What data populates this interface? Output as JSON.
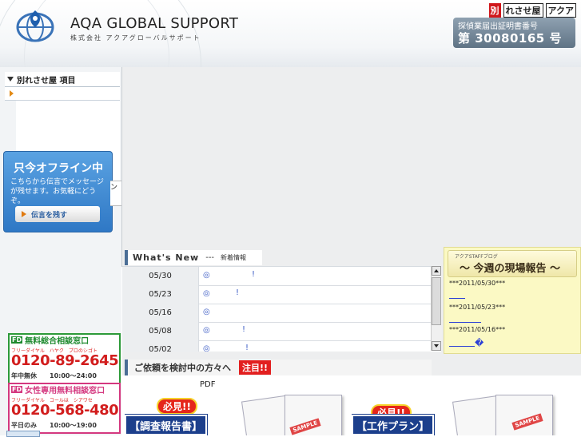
{
  "header": {
    "brand": "AQA GLOBAL SUPPORT",
    "brand_sub": "株式会社 アクアグローバルサポート",
    "tags": [
      "別",
      "れさせ屋",
      "アクア"
    ],
    "license_title": "探偵業届出証明書番号",
    "license_number": "第 30080165 号"
  },
  "left_menu": {
    "title": "別れさせ屋 項目"
  },
  "offline_widget": {
    "title": "只今オフライン中",
    "text": "こちらから伝言でメッセージが残せます。お気軽にどうぞ。",
    "button": "伝言を残す",
    "edge_label": "ン"
  },
  "phones": [
    {
      "title": "無料総合相談窓口",
      "small": "フリーダイヤル　ハヤク　プロのシゴト",
      "number": "0120-89-2645",
      "hours": "年中無休　　10:00〜24:00"
    },
    {
      "title": "女性専用無料相談窓口",
      "small": "フリーダイヤル　コールは　シアワセ",
      "number": "0120-568-480",
      "hours": "平日のみ　　10:00〜19:00"
    }
  ],
  "news": {
    "title_en": "What's New",
    "sep": "---",
    "title_jp": "新着情報",
    "icon": "◎",
    "rows": [
      {
        "date": "05/30",
        "mark": "!"
      },
      {
        "date": "05/23",
        "mark": "!"
      },
      {
        "date": "05/16",
        "mark": ""
      },
      {
        "date": "05/08",
        "mark": "!"
      },
      {
        "date": "05/02",
        "mark": "!"
      }
    ]
  },
  "blog": {
    "small": "アクアSTAFFブログ",
    "title": "～ 今週の現場報告 ～",
    "entries": [
      "***2011/05/30***",
      "***2011/05/23***",
      "***2011/05/16***"
    ],
    "last_glyph": "�"
  },
  "request": {
    "text": "ご依頼を検討中の方々へ",
    "badge": "注目!!",
    "pdf": "PDF"
  },
  "promos": [
    {
      "hit": "必見!!",
      "label": "【調査報告書】",
      "stamp": "SAMPLE"
    },
    {
      "hit": "必見!!",
      "label": "【工作プラン】",
      "stamp": "SAMPLE"
    }
  ]
}
